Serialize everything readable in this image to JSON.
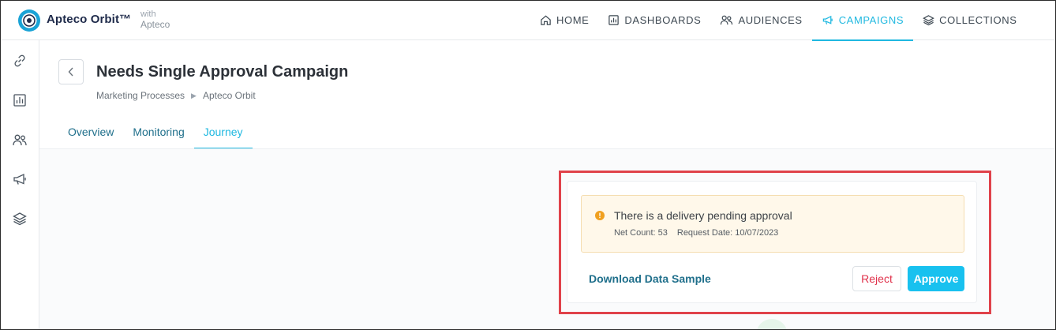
{
  "topbar": {
    "brand": "Apteco Orbit™",
    "with_line1": "with",
    "with_line2": "Apteco",
    "nav": [
      {
        "label": "HOME",
        "icon": "home-icon"
      },
      {
        "label": "DASHBOARDS",
        "icon": "dashboard-icon"
      },
      {
        "label": "AUDIENCES",
        "icon": "audiences-icon"
      },
      {
        "label": "CAMPAIGNS",
        "icon": "megaphone-icon",
        "active": true
      },
      {
        "label": "COLLECTIONS",
        "icon": "layers-icon"
      }
    ]
  },
  "sidebar": {
    "items": [
      {
        "icon": "link-icon"
      },
      {
        "icon": "dashboard-icon"
      },
      {
        "icon": "audiences-icon"
      },
      {
        "icon": "megaphone-icon"
      },
      {
        "icon": "layers-icon"
      }
    ]
  },
  "header": {
    "title": "Needs Single Approval Campaign",
    "breadcrumb": [
      "Marketing Processes",
      "Apteco Orbit"
    ],
    "tabs": [
      {
        "label": "Overview"
      },
      {
        "label": "Monitoring"
      },
      {
        "label": "Journey",
        "active": true
      }
    ]
  },
  "approval": {
    "title": "There is a delivery pending approval",
    "net_count": "Net Count: 53",
    "request_date": "Request Date: 10/07/2023",
    "download_label": "Download Data Sample",
    "reject_label": "Reject",
    "approve_label": "Approve"
  },
  "colors": {
    "accent": "#1fb8e0",
    "link": "#1f6f8b",
    "reject": "#e0304a",
    "approve_bg": "#18c1ef",
    "highlight": "#e0424a",
    "alert_bg": "#fff8ea",
    "alert_icon": "#f0a020"
  }
}
